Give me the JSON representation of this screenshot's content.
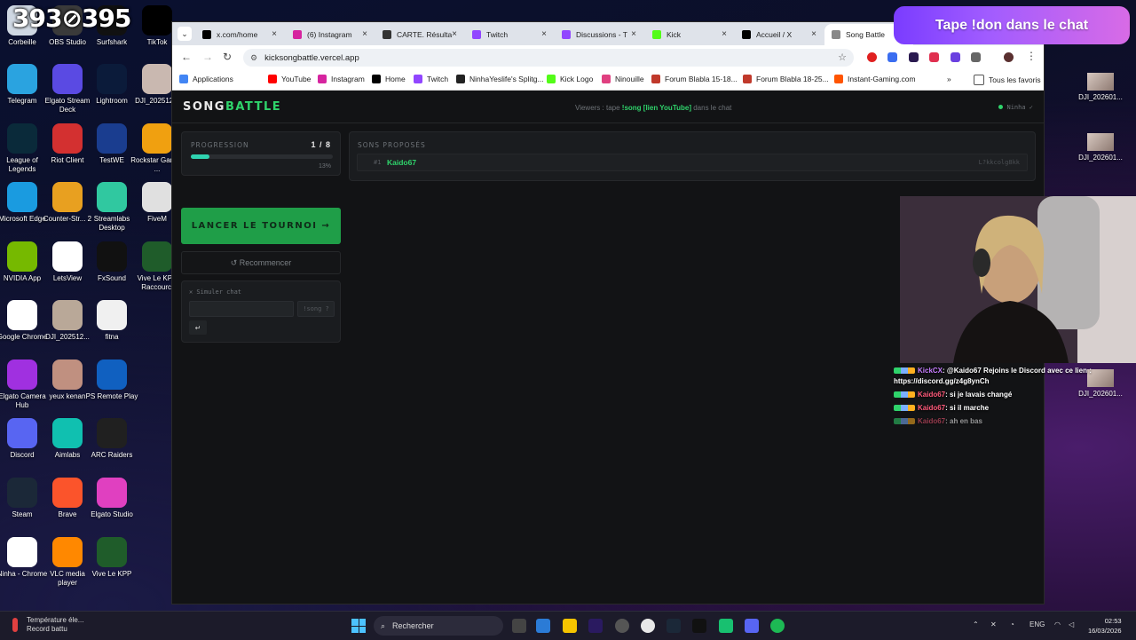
{
  "overlay_counter": "393⊘395",
  "desktop_icons": [
    {
      "label": "Corbeille",
      "color": "#cfd8e3",
      "icon": "recycle-bin-icon"
    },
    {
      "label": "OBS Studio",
      "color": "#3a3a3a",
      "icon": "obs-icon"
    },
    {
      "label": "Surfshark",
      "color": "#111111",
      "icon": "surfshark-icon"
    },
    {
      "label": "TikTok",
      "color": "#000000",
      "icon": "tiktok-icon"
    },
    {
      "label": "Telegram",
      "color": "#2aa3e0",
      "icon": "telegram-icon"
    },
    {
      "label": "Elgato Stream Deck",
      "color": "#5a4ae3",
      "icon": "stream-deck-icon"
    },
    {
      "label": "Lightroom",
      "color": "#0b1b3a",
      "icon": "lightroom-icon"
    },
    {
      "label": "DJI_202512...",
      "color": "#c9b8b0",
      "icon": "image-thumbnail-icon"
    },
    {
      "label": "League of Legends",
      "color": "#0a2a3a",
      "icon": "league-icon"
    },
    {
      "label": "Riot Client",
      "color": "#d33030",
      "icon": "riot-icon"
    },
    {
      "label": "TestWE",
      "color": "#1a3d8f",
      "icon": "testwe-icon"
    },
    {
      "label": "Rockstar Games ...",
      "color": "#f0a010",
      "icon": "rockstar-icon"
    },
    {
      "label": "Microsoft Edge",
      "color": "#1a9be0",
      "icon": "edge-icon"
    },
    {
      "label": "Counter-Str... 2",
      "color": "#e8a020",
      "icon": "cs2-icon"
    },
    {
      "label": "Streamlabs Desktop",
      "color": "#30c8a0",
      "icon": "streamlabs-icon"
    },
    {
      "label": "FiveM",
      "color": "#e0e0e0",
      "icon": "fivem-icon"
    },
    {
      "label": "NVIDIA App",
      "color": "#76b900",
      "icon": "nvidia-icon"
    },
    {
      "label": "LetsView",
      "color": "#ffffff",
      "icon": "letsview-icon"
    },
    {
      "label": "FxSound",
      "color": "#111111",
      "icon": "fxsound-icon"
    },
    {
      "label": "Vive Le KPP Raccourci",
      "color": "#1f5c2a",
      "icon": "kpp-icon"
    },
    {
      "label": "Google Chrome",
      "color": "#ffffff",
      "icon": "chrome-icon"
    },
    {
      "label": "DJI_202512...",
      "color": "#b9a898",
      "icon": "image-thumbnail-icon"
    },
    {
      "label": "fitna",
      "color": "#f0f0f0",
      "icon": "file-icon"
    },
    {
      "label": "Elgato Camera Hub",
      "color": "#a030e0",
      "icon": "camera-hub-icon"
    },
    {
      "label": "yeux kenan",
      "color": "#c09080",
      "icon": "image-thumbnail-icon"
    },
    {
      "label": "PS Remote Play",
      "color": "#1060c0",
      "icon": "ps-remote-icon"
    },
    {
      "label": "Discord",
      "color": "#5865f2",
      "icon": "discord-icon"
    },
    {
      "label": "Aimlabs",
      "color": "#10c0b0",
      "icon": "aimlabs-icon"
    },
    {
      "label": "ARC Raiders",
      "color": "#202020",
      "icon": "arc-raiders-icon"
    },
    {
      "label": "Steam",
      "color": "#1b2838",
      "icon": "steam-icon"
    },
    {
      "label": "Brave",
      "color": "#fb542b",
      "icon": "brave-icon"
    },
    {
      "label": "Elgato Studio",
      "color": "#e040c0",
      "icon": "elgato-studio-icon"
    },
    {
      "label": "Ninha - Chrome",
      "color": "#ffffff",
      "icon": "chrome-icon"
    },
    {
      "label": "VLC media player",
      "color": "#ff8800",
      "icon": "vlc-icon"
    },
    {
      "label": "Vive Le KPP",
      "color": "#1f5c2a",
      "icon": "kpp-icon"
    }
  ],
  "right_thumbs": [
    {
      "label": "DJI_202601..."
    },
    {
      "label": "DJI_202601..."
    },
    {
      "label": "DJI_202601..."
    }
  ],
  "browser": {
    "tabs": [
      {
        "label": "x.com/home",
        "fav": "#000000"
      },
      {
        "label": "(6) Instagram",
        "fav": "#d6249f"
      },
      {
        "label": "CARTE. Résulta",
        "fav": "#333333"
      },
      {
        "label": "Twitch",
        "fav": "#9146ff"
      },
      {
        "label": "Discussions - T",
        "fav": "#9146ff"
      },
      {
        "label": "Kick",
        "fav": "#53fc18"
      },
      {
        "label": "Accueil / X",
        "fav": "#000000"
      },
      {
        "label": "Song Battle",
        "fav": "#888888"
      }
    ],
    "url": "kicksongbattle.vercel.app",
    "bookmarks": [
      {
        "label": "Applications",
        "fav": "#4285f4"
      },
      {
        "label": "YouTube",
        "fav": "#ff0000"
      },
      {
        "label": "Instagram",
        "fav": "#d6249f"
      },
      {
        "label": "Home",
        "fav": "#000000"
      },
      {
        "label": "Twitch",
        "fav": "#9146ff"
      },
      {
        "label": "NinhaYeslife's Splitg...",
        "fav": "#222222"
      },
      {
        "label": "Kick Logo",
        "fav": "#53fc18"
      },
      {
        "label": "Ninouille",
        "fav": "#e04080"
      },
      {
        "label": "Forum Blabla 15-18...",
        "fav": "#c0392b"
      },
      {
        "label": "Forum Blabla 18-25...",
        "fav": "#c0392b"
      },
      {
        "label": "Instant-Gaming.com",
        "fav": "#ff5400"
      }
    ],
    "all_bookmarks": "Tous les favoris"
  },
  "app": {
    "logo_a": "SONG",
    "logo_b": "BATTLE",
    "hint_pre": "Viewers : tape",
    "hint_cmd": "!song [lien YouTube]",
    "hint_post": "dans le chat",
    "user": "Ninha ✓",
    "progress_label": "PROGRESSION",
    "progress_count": "1 / 8",
    "progress_pct": "13%",
    "progress_value": 0.13,
    "launch_label": "LANCER LE TOURNOI →",
    "restart_label": "↺ Recommencer",
    "sim_label": "✕ Simuler chat",
    "sim_cmd": "!song ?",
    "sim_send": "↵",
    "songs_label": "SONS PROPOSÉS",
    "songs": [
      {
        "num": "#1",
        "name": "Kaido67",
        "id": "L?kkcolg8kk"
      }
    ]
  },
  "overlay": {
    "don_text": "Tape !don dans le chat"
  },
  "chat": [
    {
      "user": "KickCX",
      "text": ": @Kaido67 Rejoins le Discord avec ce lien : https://discord.gg/z4g8ynCh",
      "cls": "u1",
      "faded": false
    },
    {
      "user": "Kaido67",
      "text": ": si je lavais changé",
      "cls": "u2",
      "faded": false
    },
    {
      "user": "Kaido67",
      "text": ": si il marche",
      "cls": "u2",
      "faded": false
    },
    {
      "user": "Kaido67",
      "text": ": ah en bas",
      "cls": "u2",
      "faded": true
    }
  ],
  "taskbar": {
    "notif_title": "Température éle...",
    "notif_sub": "Record battu",
    "search": "Rechercher",
    "lang": "ENG",
    "time": "02:53",
    "date": "16/03/2026"
  }
}
